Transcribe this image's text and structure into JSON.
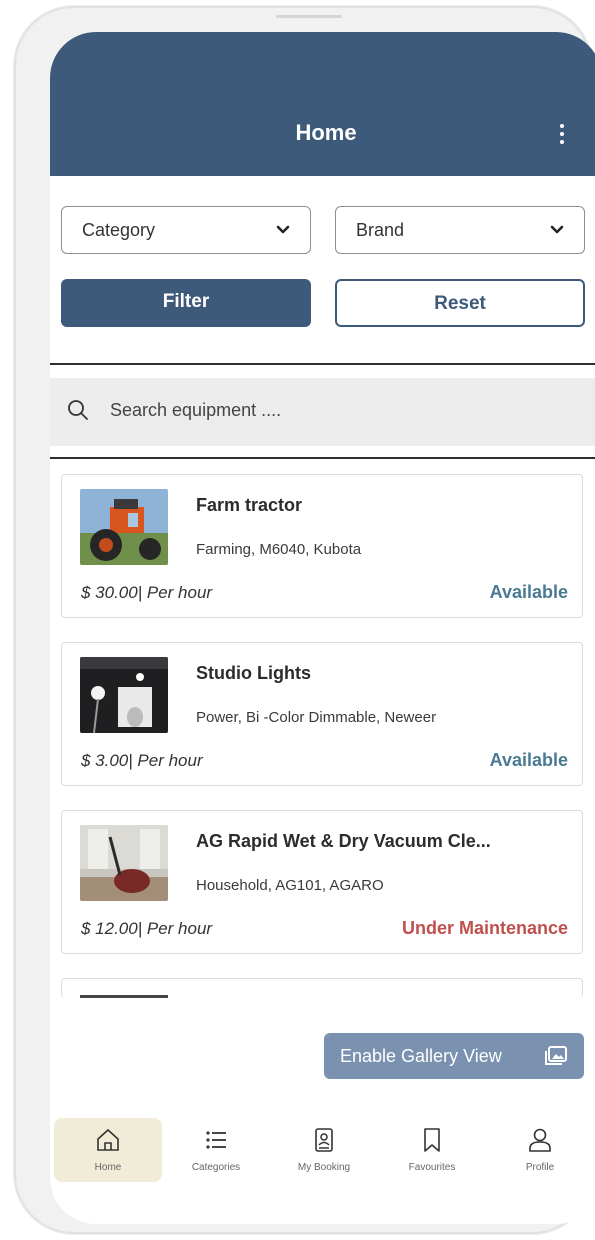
{
  "header": {
    "title": "Home"
  },
  "filters": {
    "category_label": "Category",
    "brand_label": "Brand",
    "filter_label": "Filter",
    "reset_label": "Reset"
  },
  "search": {
    "placeholder": "Search equipment ...."
  },
  "equipment": [
    {
      "title": "Farm tractor",
      "details": "Farming, M6040, Kubota",
      "price": "$ 30.00| Per hour",
      "status": "Available",
      "status_color": "#4a7a92"
    },
    {
      "title": "Studio Lights",
      "details": "Power, Bi -Color Dimmable, Neweer",
      "price": "$ 3.00| Per hour",
      "status": "Available",
      "status_color": "#4a7a92"
    },
    {
      "title": "AG Rapid Wet & Dry Vacuum Cle...",
      "details": "Household, AG101, AGARO",
      "price": "$ 12.00| Per hour",
      "status": "Under Maintenance",
      "status_color": "#c0504d"
    }
  ],
  "gallery_button": {
    "label": "Enable Gallery View",
    "icon": "gallery-icon"
  },
  "bottom_nav": [
    {
      "label": "Home",
      "icon": "home-icon",
      "active": true
    },
    {
      "label": "Categories",
      "icon": "list-icon",
      "active": false
    },
    {
      "label": "My Booking",
      "icon": "booking-icon",
      "active": false
    },
    {
      "label": "Favourites",
      "icon": "bookmark-icon",
      "active": false
    },
    {
      "label": "Profile",
      "icon": "profile-icon",
      "active": false
    }
  ],
  "colors": {
    "primary": "#3d5a7a",
    "available": "#4a7a92",
    "maintenance": "#c0504d",
    "gallery_button": "#7a91b0",
    "active_nav": "#f1ecd8"
  }
}
